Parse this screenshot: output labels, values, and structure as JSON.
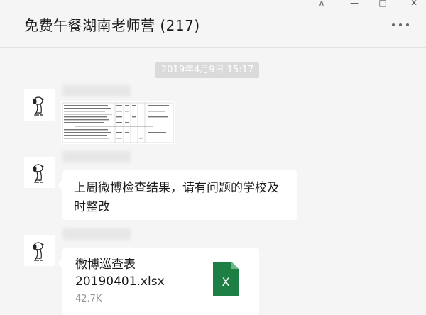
{
  "header": {
    "title": "免费午餐湖南老师营 (217)",
    "window_controls": {
      "pin": "⊼",
      "minimize": "—",
      "maximize": "□",
      "close": "✕"
    },
    "more_icon": "more-icon"
  },
  "timestamp": "2019年4月9日 15:17",
  "messages": [
    {
      "type": "image",
      "avatar_icon": "snoopy-avatar-icon",
      "sender_blurred": true
    },
    {
      "type": "text",
      "avatar_icon": "snoopy-avatar-icon",
      "sender_blurred": true,
      "text": "上周微博检查结果，请有问题的学校及时整改"
    },
    {
      "type": "file",
      "avatar_icon": "snoopy-avatar-icon",
      "sender_blurred": true,
      "file_name": "微博巡查表20190401.xlsx",
      "file_size": "42.7K",
      "file_icon": "excel-file-icon",
      "file_icon_letter": "X"
    }
  ],
  "colors": {
    "background": "#f5f5f5",
    "bubble": "#ffffff",
    "excel_green": "#1d7f43",
    "timestamp_bg": "#dadada"
  }
}
